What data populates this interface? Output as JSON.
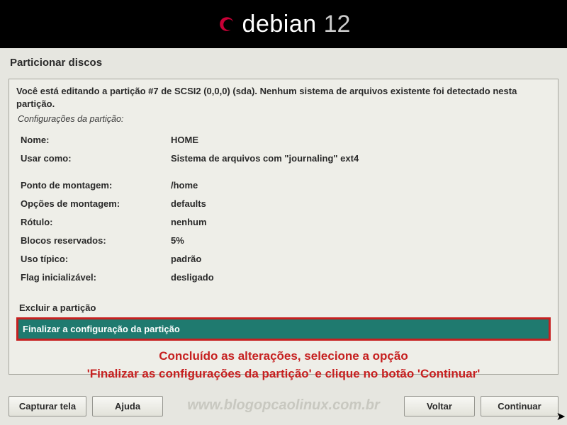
{
  "header": {
    "brand": "debian",
    "version": "12"
  },
  "page_title": "Particionar discos",
  "intro": "Você está editando a partição #7 de SCSI2 (0,0,0) (sda). Nenhum sistema de arquivos existente foi detectado nesta partição.",
  "subtitle": "Configurações da partição:",
  "props": {
    "name_label": "Nome:",
    "name_value": "HOME",
    "useas_label": "Usar como:",
    "useas_value": "Sistema de arquivos com \"journaling\" ext4",
    "mount_label": "Ponto de montagem:",
    "mount_value": "/home",
    "mountopts_label": "Opções de montagem:",
    "mountopts_value": "defaults",
    "label_label": "Rótulo:",
    "label_value": "nenhum",
    "reserved_label": "Blocos reservados:",
    "reserved_value": "5%",
    "usage_label": "Uso típico:",
    "usage_value": "padrão",
    "bootflag_label": "Flag inicializável:",
    "bootflag_value": "desligado"
  },
  "actions": {
    "delete": "Excluir a partição",
    "finish": "Finalizar a configuração da partição"
  },
  "annotation_line1": "Concluído as alterações, selecione a opção",
  "annotation_line2": "'Finalizar as configurações da partição' e clique no botão 'Continuar'",
  "buttons": {
    "screenshot": "Capturar tela",
    "help": "Ajuda",
    "back": "Voltar",
    "continue": "Continuar"
  },
  "watermark": "www.blogopcaolinux.com.br"
}
